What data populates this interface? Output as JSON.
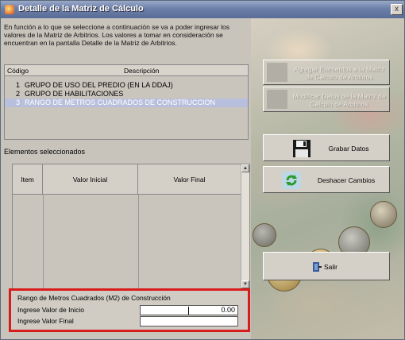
{
  "window": {
    "title": "Detalle de la Matriz de Cálculo",
    "close_label": "x"
  },
  "instructions": "En función a lo que se seleccione a continuación se va a poder ingresar los valores de la Matriz de Arbitrios. Los valores a tomar en consideración se encuentran en la pantalla Detalle de la Matriz de Arbitrios.",
  "codes_list": {
    "headers": {
      "code": "Código",
      "description": "Descripción"
    },
    "rows": [
      {
        "code": "1",
        "description": "GRUPO DE USO DEL PREDIO (EN LA DDAJ)",
        "selected": false
      },
      {
        "code": "2",
        "description": "GRUPO DE HABILITACIONES",
        "selected": false
      },
      {
        "code": "3",
        "description": "RANGO DE METROS CUADRADOS DE CONSTRUCCION",
        "selected": true
      }
    ]
  },
  "selected_label": "Elementos seleccionados",
  "items_table": {
    "headers": {
      "item": "Item",
      "initial": "Valor Inicial",
      "final": "Valor Final"
    }
  },
  "form": {
    "title": "Rango de Metros Cuadrados (M2) de Construcción",
    "start_label": "Ingrese Valor de Inicio",
    "start_value": "0.00",
    "end_label": "Ingrese Valor Final",
    "end_value": ""
  },
  "buttons": {
    "add": "Agregar Elementos a la Matriz de Cálculo de Arbitrios",
    "modify": "Modificar Datos de la Matriz de Cálculo de Arbitrios",
    "save": "Grabar Datos",
    "undo": "Deshacer Cambios",
    "exit": "Salir"
  },
  "icons": {
    "title": "app-icon",
    "save": "floppy-disk-icon",
    "undo": "refresh-icon",
    "exit": "door-exit-icon"
  },
  "colors": {
    "highlight_border": "#d81c1c",
    "selection": "#b8bfdc",
    "titlebar": "#6b7fa8"
  }
}
